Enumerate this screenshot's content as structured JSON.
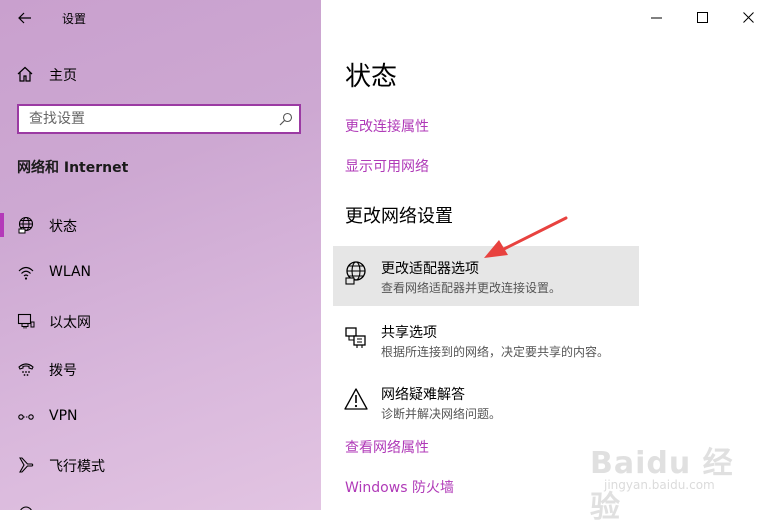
{
  "window": {
    "title": "设置"
  },
  "sidebar": {
    "home_label": "主页",
    "search_placeholder": "查找设置",
    "section_title": "网络和 Internet",
    "items": [
      {
        "label": "状态",
        "icon": "globe-icon",
        "selected": true
      },
      {
        "label": "WLAN",
        "icon": "wifi-icon"
      },
      {
        "label": "以太网",
        "icon": "ethernet-icon"
      },
      {
        "label": "拨号",
        "icon": "dialup-icon"
      },
      {
        "label": "VPN",
        "icon": "vpn-icon"
      },
      {
        "label": "飞行模式",
        "icon": "airplane-icon"
      }
    ]
  },
  "main": {
    "title": "状态",
    "links": {
      "change_connection_properties": "更改连接属性",
      "show_available_networks": "显示可用网络",
      "view_network_properties": "查看网络属性",
      "windows_firewall": "Windows 防火墙"
    },
    "section_title": "更改网络设置",
    "options": [
      {
        "title": "更改适配器选项",
        "subtitle": "查看网络适配器并更改连接设置。",
        "icon": "adapter-globe-icon"
      },
      {
        "title": "共享选项",
        "subtitle": "根据所连接到的网络，决定要共享的内容。",
        "icon": "sharing-icon"
      },
      {
        "title": "网络疑难解答",
        "subtitle": "诊断并解决网络问题。",
        "icon": "warning-icon"
      }
    ]
  },
  "watermark": {
    "brand": "Baidu 经验",
    "url": "jingyan.baidu.com"
  },
  "colors": {
    "accent": "#b03ab8",
    "arrow": "#e8423f",
    "hover": "#e6e6e6"
  }
}
